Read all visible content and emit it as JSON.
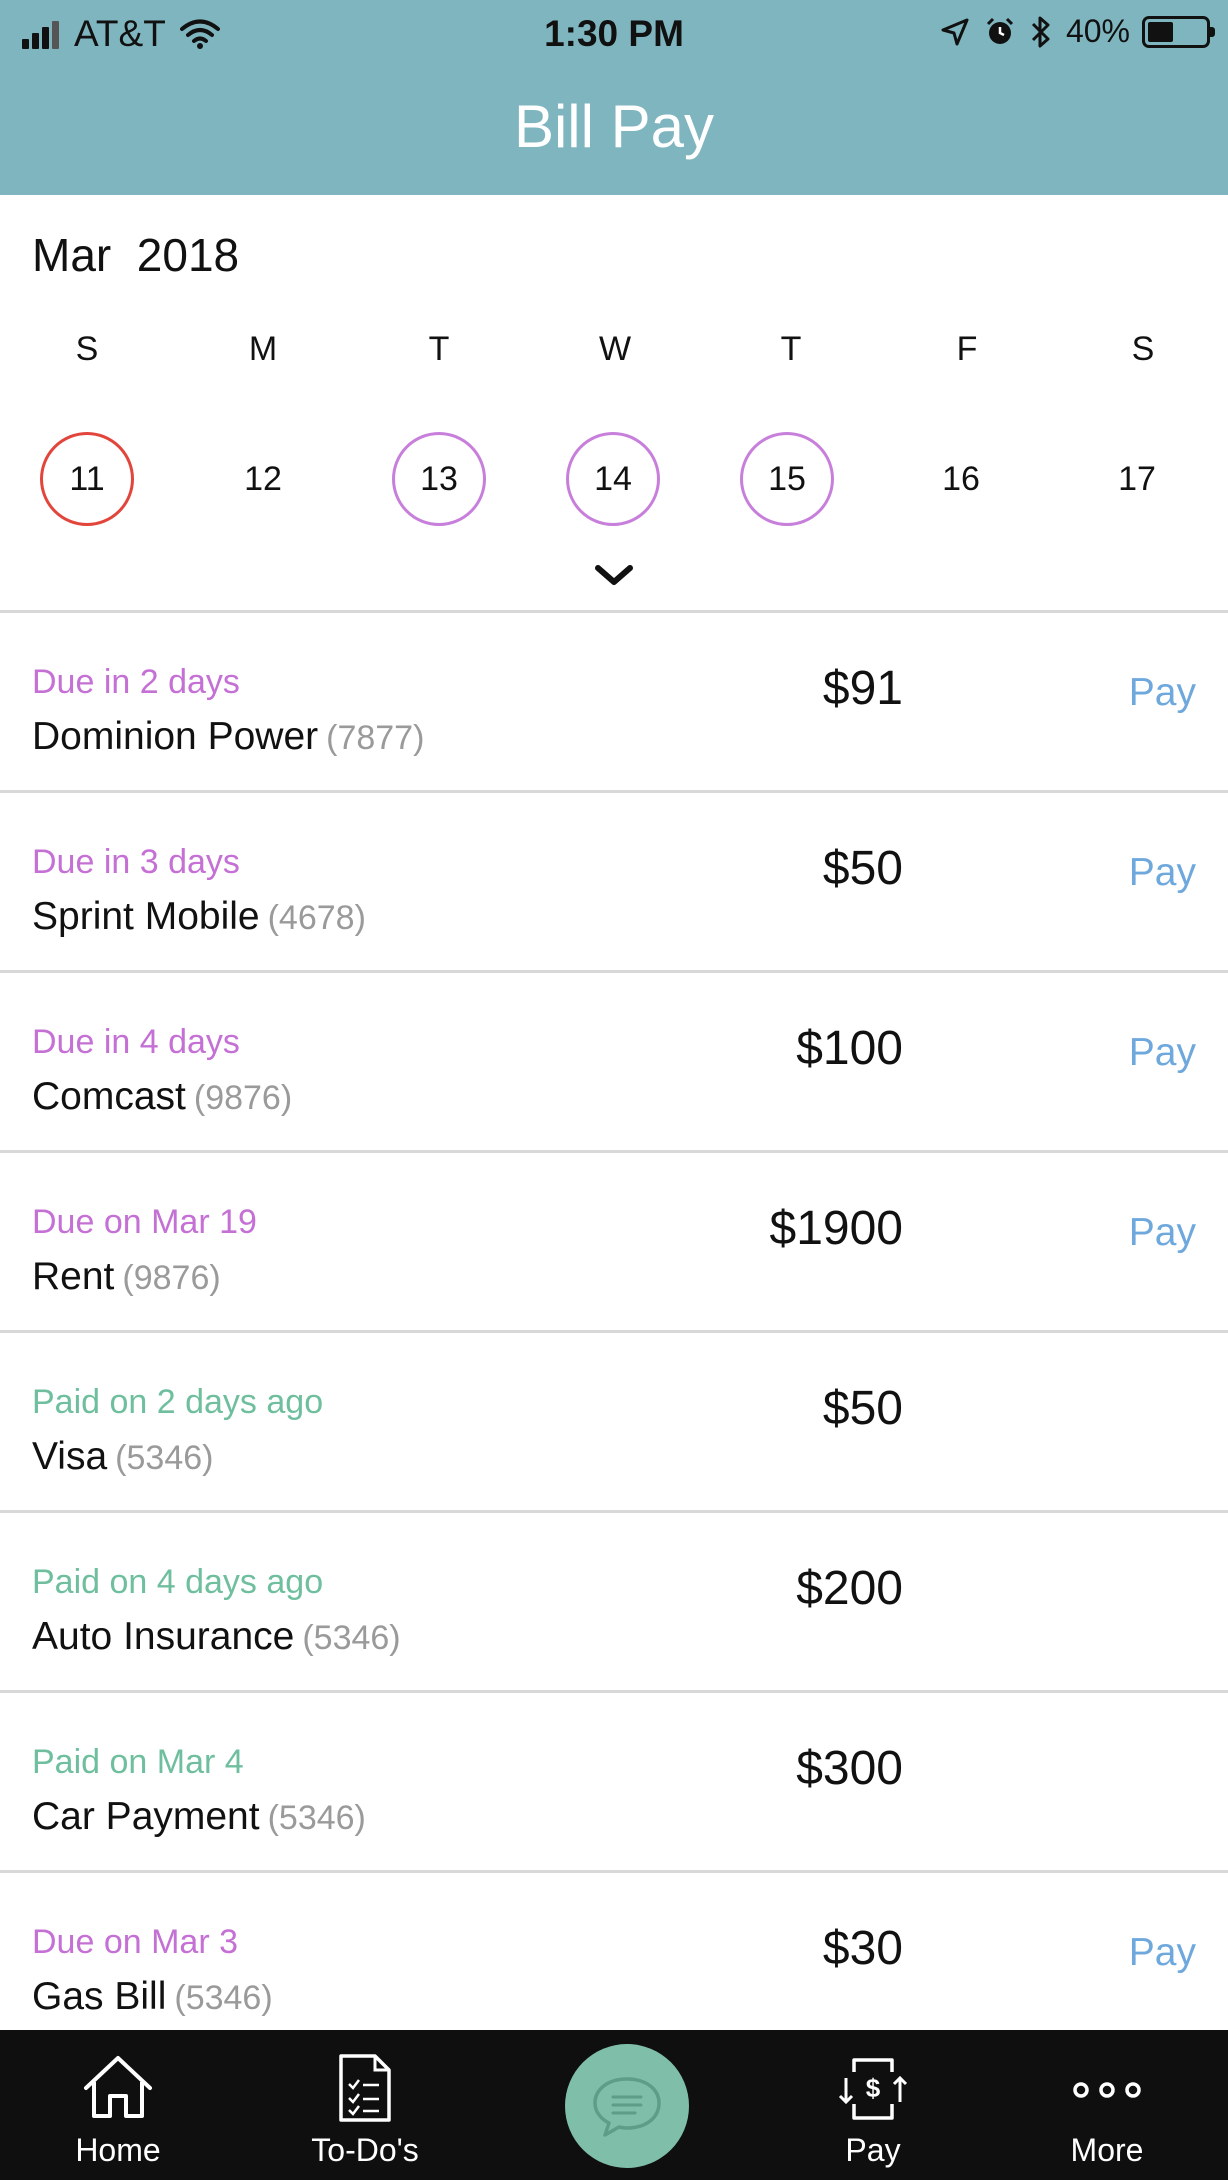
{
  "status_bar": {
    "carrier": "AT&T",
    "time": "1:30 PM",
    "battery": "40%",
    "battery_level": 0.4
  },
  "header": {
    "title": "Bill Pay"
  },
  "calendar": {
    "month": "Mar",
    "year": "2018",
    "weekdays": [
      "S",
      "M",
      "T",
      "W",
      "T",
      "F",
      "S"
    ],
    "days": [
      {
        "label": "11",
        "state": "today"
      },
      {
        "label": "12",
        "state": "none"
      },
      {
        "label": "13",
        "state": "due"
      },
      {
        "label": "14",
        "state": "due"
      },
      {
        "label": "15",
        "state": "due"
      },
      {
        "label": "16",
        "state": "none"
      },
      {
        "label": "17",
        "state": "none"
      }
    ],
    "colors": {
      "today": "#e2453b",
      "due": "#c77fdb"
    }
  },
  "bills": [
    {
      "status": "Due in 2 days",
      "kind": "due",
      "name": "Dominion Power",
      "account": "(7877)",
      "amount": "$91",
      "action": "Pay"
    },
    {
      "status": "Due in 3 days",
      "kind": "due",
      "name": "Sprint Mobile",
      "account": "(4678)",
      "amount": "$50",
      "action": "Pay"
    },
    {
      "status": "Due in 4 days",
      "kind": "due",
      "name": "Comcast",
      "account": "(9876)",
      "amount": "$100",
      "action": "Pay"
    },
    {
      "status": "Due on Mar 19",
      "kind": "due",
      "name": "Rent",
      "account": "(9876)",
      "amount": "$1900",
      "action": "Pay"
    },
    {
      "status": "Paid on 2 days ago",
      "kind": "paid",
      "name": "Visa",
      "account": "(5346)",
      "amount": "$50",
      "action": ""
    },
    {
      "status": "Paid on 4 days ago",
      "kind": "paid",
      "name": "Auto Insurance",
      "account": "(5346)",
      "amount": "$200",
      "action": ""
    },
    {
      "status": "Paid on Mar 4",
      "kind": "paid",
      "name": "Car Payment",
      "account": "(5346)",
      "amount": "$300",
      "action": ""
    },
    {
      "status": "Due on Mar 3",
      "kind": "due",
      "name": "Gas Bill",
      "account": "(5346)",
      "amount": "$30",
      "action": "Pay"
    }
  ],
  "tabbar": {
    "home": {
      "label": "Home",
      "icon": "home-icon"
    },
    "todos": {
      "label": "To-Do's",
      "icon": "checklist-icon"
    },
    "chat": {
      "icon": "chat-bubble-icon"
    },
    "pay": {
      "label": "Pay",
      "icon": "pay-icon"
    },
    "more": {
      "label": "More",
      "icon": "more-dots-icon"
    }
  },
  "colors": {
    "header_bg": "#7fb5bf",
    "due_text": "#c470d4",
    "paid_text": "#6fbf9f",
    "pay_link": "#6fa8dc",
    "chat_button": "#7fbfa9",
    "tabbar_bg": "#0f0f0f"
  }
}
